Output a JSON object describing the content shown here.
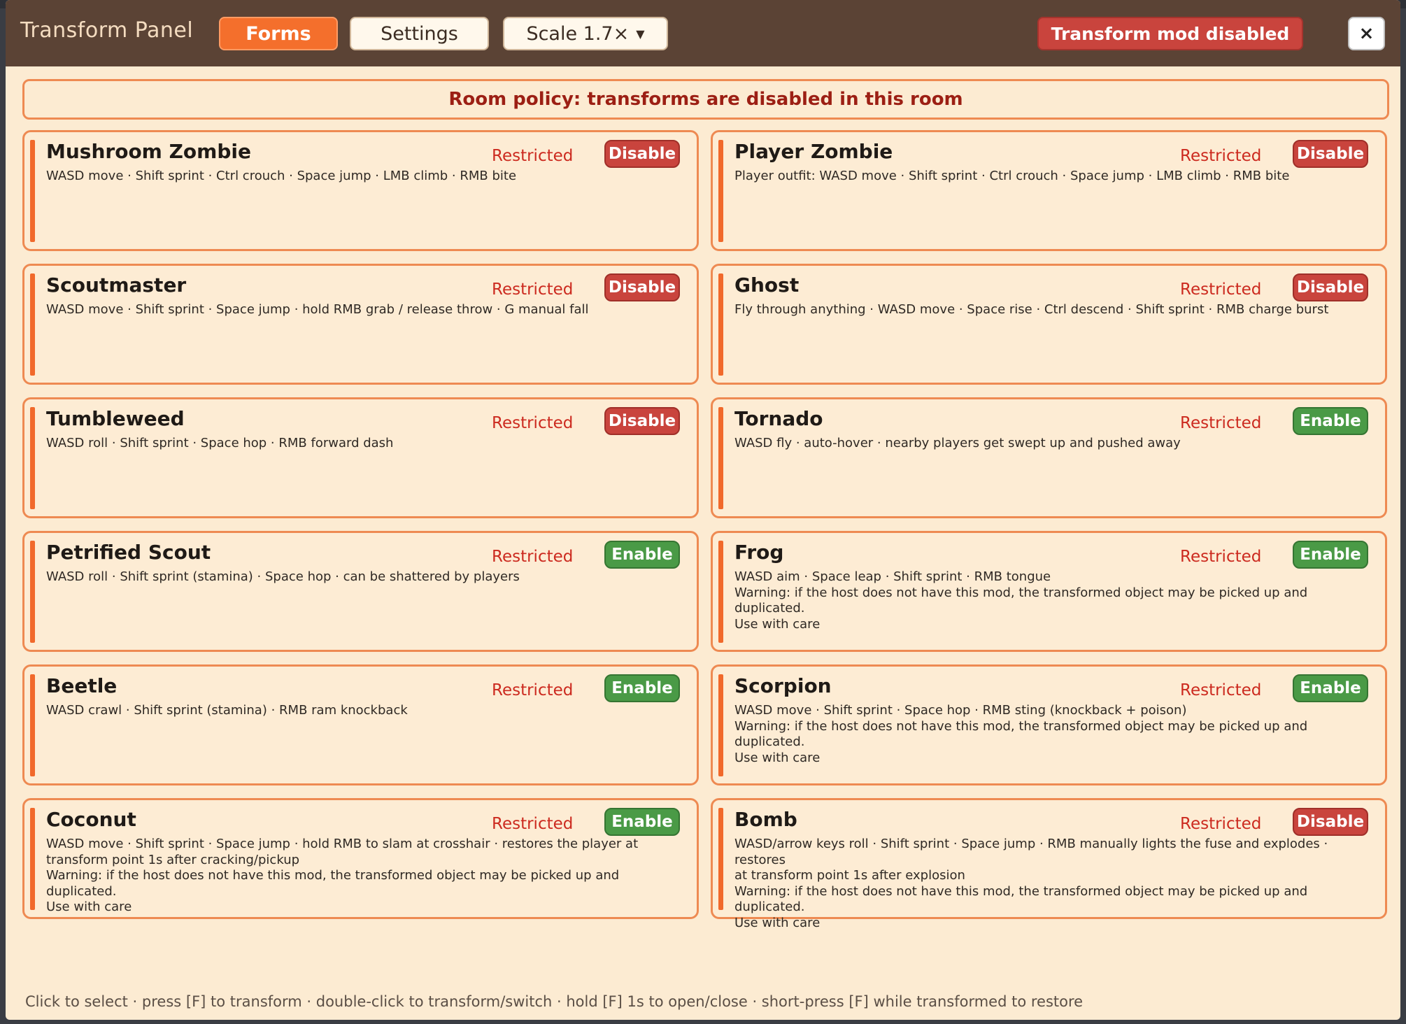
{
  "header": {
    "title": "Transform Panel",
    "tabs": [
      {
        "label": "Forms",
        "active": true
      },
      {
        "label": "Settings",
        "active": false
      }
    ],
    "scale": {
      "label": "Scale 1.7×",
      "chevron": "▼"
    },
    "mod_status": "Transform mod disabled",
    "close_label": "×"
  },
  "policy_banner": "Room policy: transforms are disabled in this room",
  "cards": [
    {
      "name": "Mushroom Zombie",
      "status": "Restricted",
      "action": "Disable",
      "description": "WASD move · Shift sprint · Ctrl crouch · Space jump · LMB climb · RMB bite"
    },
    {
      "name": "Player Zombie",
      "status": "Restricted",
      "action": "Disable",
      "description": "Player outfit: WASD move · Shift sprint · Ctrl crouch · Space jump · LMB climb · RMB bite"
    },
    {
      "name": "Scoutmaster",
      "status": "Restricted",
      "action": "Disable",
      "description": "WASD move · Shift sprint · Space jump · hold RMB grab / release throw · G manual fall"
    },
    {
      "name": "Ghost",
      "status": "Restricted",
      "action": "Disable",
      "description": "Fly through anything · WASD move · Space rise · Ctrl descend · Shift sprint · RMB charge burst"
    },
    {
      "name": "Tumbleweed",
      "status": "Restricted",
      "action": "Disable",
      "description": "WASD roll · Shift sprint · Space hop · RMB forward dash"
    },
    {
      "name": "Tornado",
      "status": "Restricted",
      "action": "Enable",
      "description": "WASD fly · auto-hover · nearby players get swept up and pushed away"
    },
    {
      "name": "Petrified Scout",
      "status": "Restricted",
      "action": "Enable",
      "description": "WASD roll · Shift sprint (stamina) · Space hop · can be shattered by players"
    },
    {
      "name": "Frog",
      "status": "Restricted",
      "action": "Enable",
      "description": "WASD aim · Space leap · Shift sprint · RMB tongue\nWarning: if the host does not have this mod, the transformed object may be picked up and duplicated.\nUse with care"
    },
    {
      "name": "Beetle",
      "status": "Restricted",
      "action": "Enable",
      "description": "WASD crawl · Shift sprint (stamina) · RMB ram knockback"
    },
    {
      "name": "Scorpion",
      "status": "Restricted",
      "action": "Enable",
      "description": "WASD move · Shift sprint · Space hop · RMB sting (knockback + poison)\nWarning: if the host does not have this mod, the transformed object may be picked up and duplicated.\nUse with care"
    },
    {
      "name": "Coconut",
      "status": "Restricted",
      "action": "Enable",
      "description": "WASD move · Shift sprint · Space jump · hold RMB to slam at crosshair · restores the player at\ntransform point 1s after cracking/pickup\nWarning: if the host does not have this mod, the transformed object may be picked up and duplicated.\nUse with care"
    },
    {
      "name": "Bomb",
      "status": "Restricted",
      "action": "Disable",
      "description": "WASD/arrow keys roll · Shift sprint · Space jump · RMB manually lights the fuse and explodes · restores\nat transform point 1s after explosion\nWarning: if the host does not have this mod, the transformed object may be picked up and duplicated.\nUse with care"
    }
  ],
  "footer_hint": "Click to select · press [F] to transform · double-click to transform/switch · hold [F] 1s to open/close · short-press [F] while transformed to restore",
  "colors": {
    "panel_bg": "#fcebd2",
    "header_bg": "#5b4335",
    "accent_orange": "#f46f2c",
    "card_border": "#ee8a52",
    "disable_red": "#c9443d",
    "enable_green": "#4a9a46",
    "restricted_text": "#cc2a1f"
  }
}
